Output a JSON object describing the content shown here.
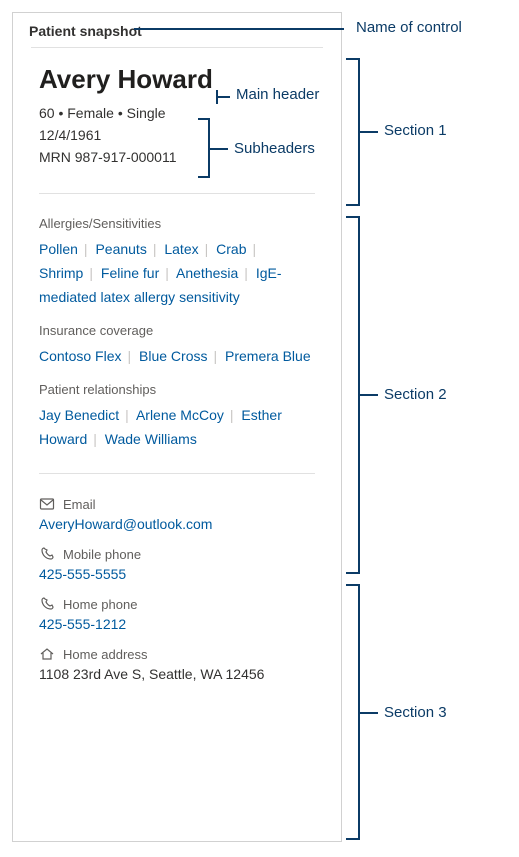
{
  "control_name_label": "Name of control",
  "card_title": "Patient snapshot",
  "main_header_annot": "Main header",
  "subheaders_annot": "Subheaders",
  "section_labels": {
    "s1": "Section 1",
    "s2": "Section 2",
    "s3": "Section 3"
  },
  "patient": {
    "name": "Avery Howard",
    "demo_line": "60 • Female • Single",
    "dob": "12/4/1961",
    "mrn": "MRN 987-917-000011"
  },
  "allergies": {
    "label": "Allergies/Sensitivities",
    "items": [
      "Pollen",
      "Peanuts",
      "Latex",
      "Crab",
      "Shrimp",
      "Feline fur",
      "Anethesia",
      "IgE-mediated latex allergy sensitivity"
    ]
  },
  "insurance": {
    "label": "Insurance coverage",
    "items": [
      "Contoso Flex",
      "Blue Cross",
      "Premera Blue"
    ]
  },
  "relationships": {
    "label": "Patient relationships",
    "items": [
      "Jay Benedict",
      "Arlene McCoy",
      "Esther Howard",
      "Wade Williams"
    ]
  },
  "contacts": {
    "email": {
      "label": "Email",
      "value": "AveryHoward@outlook.com"
    },
    "mobile": {
      "label": "Mobile phone",
      "value": "425-555-5555"
    },
    "home_phone": {
      "label": "Home phone",
      "value": "425-555-1212"
    },
    "home_address": {
      "label": "Home address",
      "value": "1108 23rd Ave S, Seattle, WA 12456"
    }
  }
}
